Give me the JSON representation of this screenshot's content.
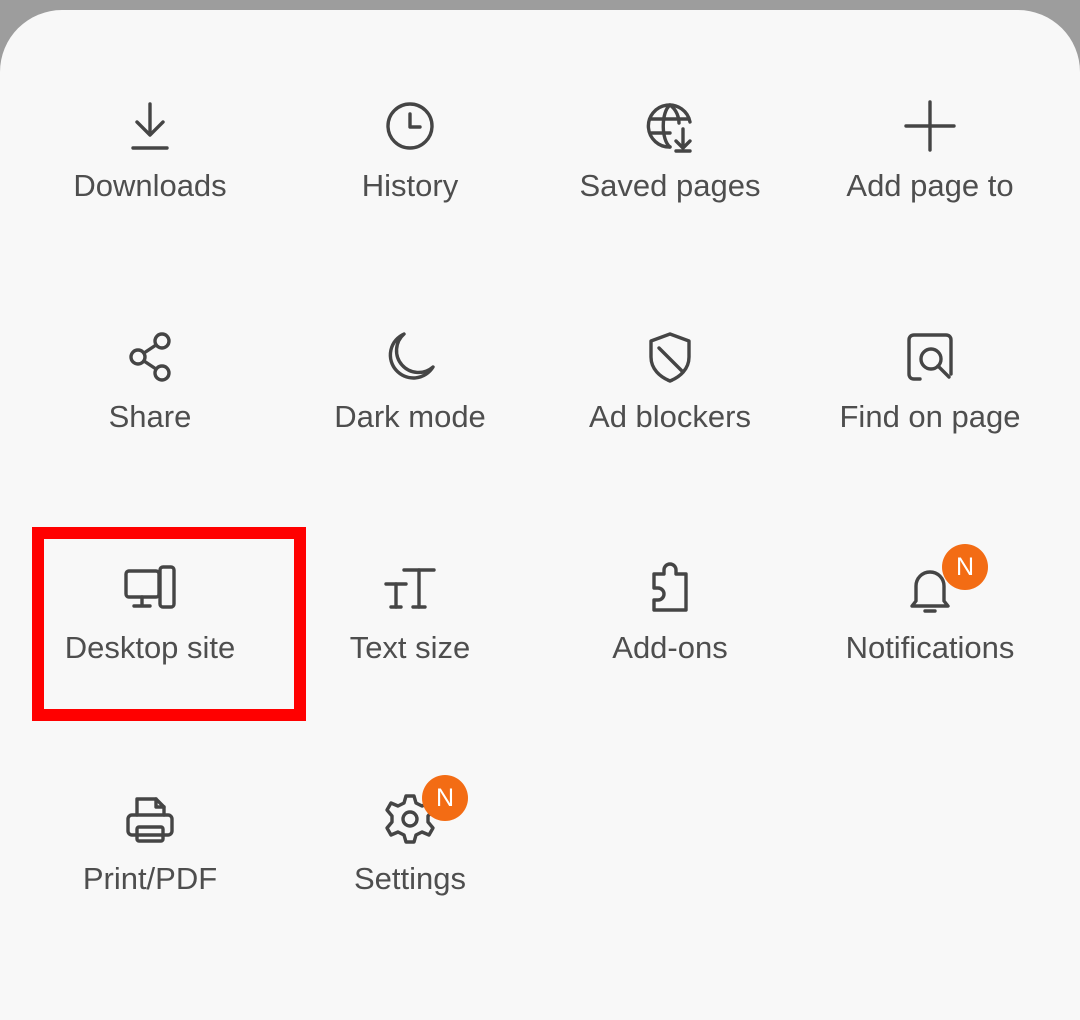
{
  "menu": {
    "items": [
      {
        "label": "Downloads",
        "icon": "download-icon"
      },
      {
        "label": "History",
        "icon": "history-icon"
      },
      {
        "label": "Saved pages",
        "icon": "saved-pages-icon"
      },
      {
        "label": "Add page to",
        "icon": "add-icon"
      },
      {
        "label": "Share",
        "icon": "share-icon"
      },
      {
        "label": "Dark mode",
        "icon": "moon-icon"
      },
      {
        "label": "Ad blockers",
        "icon": "shield-icon"
      },
      {
        "label": "Find on page",
        "icon": "find-on-page-icon"
      },
      {
        "label": "Desktop site",
        "icon": "desktop-icon"
      },
      {
        "label": "Text size",
        "icon": "text-size-icon"
      },
      {
        "label": "Add-ons",
        "icon": "puzzle-icon"
      },
      {
        "label": "Notifications",
        "icon": "bell-icon",
        "badge": "N"
      },
      {
        "label": "Print/PDF",
        "icon": "printer-icon"
      },
      {
        "label": "Settings",
        "icon": "gear-icon",
        "badge": "N"
      }
    ]
  },
  "highlight": {
    "target": "Desktop site",
    "color": "#ff0000"
  },
  "colors": {
    "text": "#4e4e4e",
    "icon": "#454545",
    "badge": "#f36c14",
    "sheet": "#f8f8f8",
    "backdrop": "#9d9d9d"
  }
}
